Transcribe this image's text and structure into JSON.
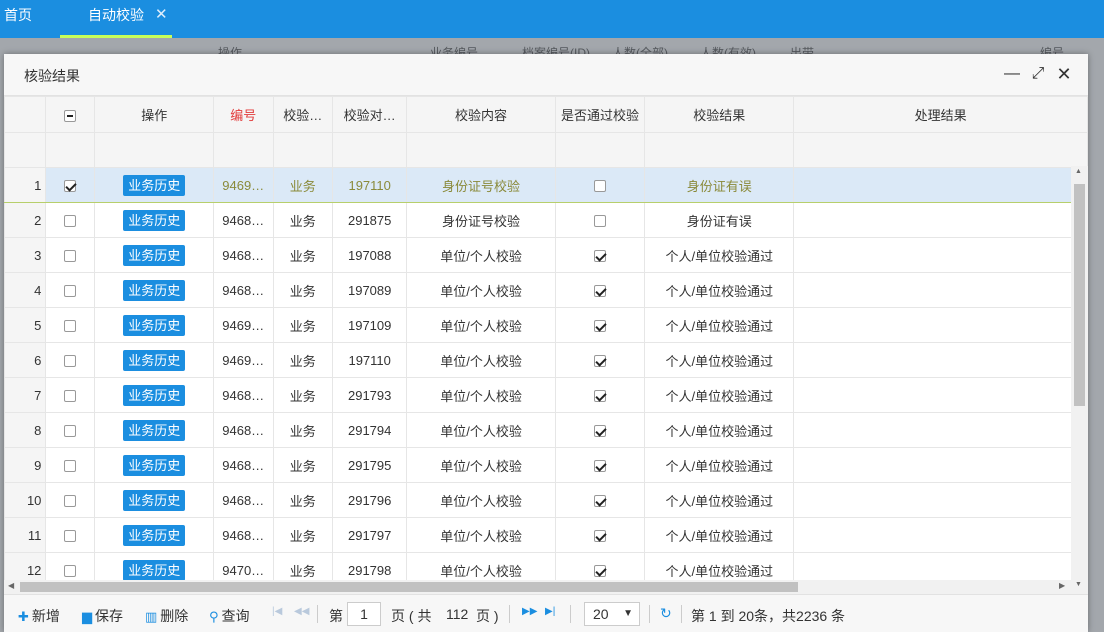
{
  "tabs": {
    "home": "首页",
    "active": "自动校验",
    "close_glyph": "✕"
  },
  "background_header": [
    "操作",
    "业务编号",
    "档案编号(ID)",
    "人数(全部)",
    "人数(有效)",
    "出带",
    "编号"
  ],
  "dialog": {
    "title": "核验结果",
    "minimize": "—",
    "maximize": "⤢",
    "close": "✕"
  },
  "columns": {
    "operation": "操作",
    "id": "编号",
    "check_type": "校验…",
    "check_object": "校验对…",
    "check_content": "校验内容",
    "passed": "是否通过校验",
    "result": "校验结果",
    "handling": "处理结果"
  },
  "history_button_label": "业务历史",
  "rows": [
    {
      "num": "1",
      "checked": true,
      "id": "9469…",
      "type": "业务",
      "object": "197110",
      "content": "身份证号校验",
      "passed": false,
      "result": "身份证有误",
      "handling": ""
    },
    {
      "num": "2",
      "checked": false,
      "id": "9468…",
      "type": "业务",
      "object": "291875",
      "content": "身份证号校验",
      "passed": false,
      "result": "身份证有误",
      "handling": ""
    },
    {
      "num": "3",
      "checked": false,
      "id": "9468…",
      "type": "业务",
      "object": "197088",
      "content": "单位/个人校验",
      "passed": true,
      "result": "个人/单位校验通过",
      "handling": ""
    },
    {
      "num": "4",
      "checked": false,
      "id": "9468…",
      "type": "业务",
      "object": "197089",
      "content": "单位/个人校验",
      "passed": true,
      "result": "个人/单位校验通过",
      "handling": ""
    },
    {
      "num": "5",
      "checked": false,
      "id": "9469…",
      "type": "业务",
      "object": "197109",
      "content": "单位/个人校验",
      "passed": true,
      "result": "个人/单位校验通过",
      "handling": ""
    },
    {
      "num": "6",
      "checked": false,
      "id": "9469…",
      "type": "业务",
      "object": "197110",
      "content": "单位/个人校验",
      "passed": true,
      "result": "个人/单位校验通过",
      "handling": ""
    },
    {
      "num": "7",
      "checked": false,
      "id": "9468…",
      "type": "业务",
      "object": "291793",
      "content": "单位/个人校验",
      "passed": true,
      "result": "个人/单位校验通过",
      "handling": ""
    },
    {
      "num": "8",
      "checked": false,
      "id": "9468…",
      "type": "业务",
      "object": "291794",
      "content": "单位/个人校验",
      "passed": true,
      "result": "个人/单位校验通过",
      "handling": ""
    },
    {
      "num": "9",
      "checked": false,
      "id": "9468…",
      "type": "业务",
      "object": "291795",
      "content": "单位/个人校验",
      "passed": true,
      "result": "个人/单位校验通过",
      "handling": ""
    },
    {
      "num": "10",
      "checked": false,
      "id": "9468…",
      "type": "业务",
      "object": "291796",
      "content": "单位/个人校验",
      "passed": true,
      "result": "个人/单位校验通过",
      "handling": ""
    },
    {
      "num": "11",
      "checked": false,
      "id": "9468…",
      "type": "业务",
      "object": "291797",
      "content": "单位/个人校验",
      "passed": true,
      "result": "个人/单位校验通过",
      "handling": ""
    },
    {
      "num": "12",
      "checked": false,
      "id": "9470…",
      "type": "业务",
      "object": "291798",
      "content": "单位/个人校验",
      "passed": true,
      "result": "个人/单位校验通过",
      "handling": ""
    }
  ],
  "toolbar": {
    "add": "新增",
    "save": "保存",
    "delete": "删除",
    "query": "查询"
  },
  "pager": {
    "page_prefix": "第",
    "current_page": "1",
    "page_suffix": "页 ( 共",
    "total_pages": "112",
    "page_end": "页 )",
    "page_size": "20",
    "summary": "第 1 到 20条，共2236 条"
  },
  "colors": {
    "primary": "#1b8ee0",
    "tab_underline": "#c8ff59",
    "header_red": "#e23b3b",
    "selected_row": "#dbe9f7"
  }
}
